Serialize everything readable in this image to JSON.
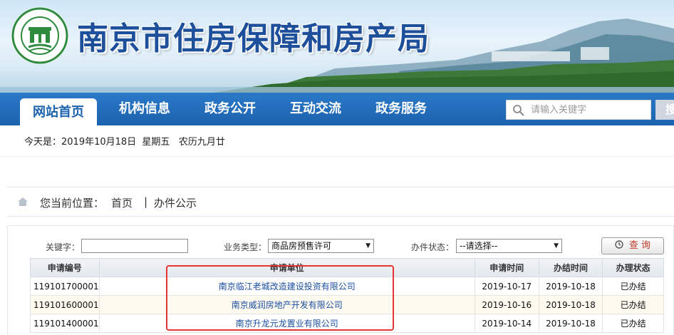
{
  "header": {
    "site_title": "南京市住房保障和房产局",
    "logo_text": "南京市住房保障和房产局"
  },
  "nav": {
    "items": [
      {
        "label": "网站首页",
        "active": true
      },
      {
        "label": "机构信息",
        "active": false
      },
      {
        "label": "政务公开",
        "active": false
      },
      {
        "label": "互动交流",
        "active": false
      },
      {
        "label": "政务服务",
        "active": false
      }
    ],
    "search_placeholder": "请输入关键字",
    "search_button_label": "搜"
  },
  "date_line": "今天是：2019年10月18日  星期五   农历九月廿",
  "breadcrumb": {
    "prefix": "您当前位置：",
    "home": "首页",
    "separator": "|",
    "current": "办件公示"
  },
  "filters": {
    "keyword_label": "关键字：",
    "keyword_value": "",
    "type_label": "业务类型：",
    "type_value": "商品房预售许可",
    "status_label": "办件状态：",
    "status_value": "--请选择--",
    "query_button": "查 询"
  },
  "table": {
    "headers": [
      "申请编号",
      "申请单位",
      "申请时间",
      "办结时间",
      "办理状态"
    ],
    "rows": [
      {
        "id": "119101700001",
        "unit": "南京临江老城改造建设投资有限公司",
        "applied": "2019-10-17",
        "completed": "2019-10-18",
        "status": "已办结"
      },
      {
        "id": "119101600001",
        "unit": "南京威润房地产开发有限公司",
        "applied": "2019-10-16",
        "completed": "2019-10-18",
        "status": "已办结"
      },
      {
        "id": "119101400001",
        "unit": "南京升龙元龙置业有限公司",
        "applied": "2019-10-14",
        "completed": "2019-10-18",
        "status": "已办结"
      }
    ]
  },
  "colors": {
    "nav_blue": "#1c62ad",
    "title_blue": "#1d4f9a",
    "logo_green": "#2e8b3e",
    "highlight_red": "#e53535",
    "link_blue": "#1a4fa1"
  }
}
